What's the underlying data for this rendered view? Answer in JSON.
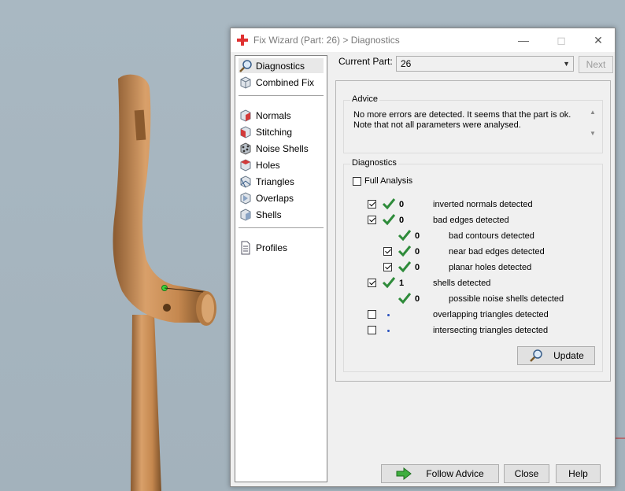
{
  "window": {
    "title": "Fix Wizard (Part: 26) > Diagnostics",
    "min_icon": "minimize-icon",
    "max_icon": "maximize-icon",
    "close_icon": "close-icon",
    "accent": "#e03131"
  },
  "nav": {
    "items": [
      {
        "label": "Diagnostics",
        "icon": "magnifier-icon",
        "selected": true
      },
      {
        "label": "Combined Fix",
        "icon": "cube-icon"
      },
      {
        "label": "Normals",
        "icon": "normals-cube-icon"
      },
      {
        "label": "Stitching",
        "icon": "stitching-cube-icon"
      },
      {
        "label": "Noise Shells",
        "icon": "noise-shells-icon"
      },
      {
        "label": "Holes",
        "icon": "holes-cube-icon"
      },
      {
        "label": "Triangles",
        "icon": "triangles-cube-icon"
      },
      {
        "label": "Overlaps",
        "icon": "overlaps-icon"
      },
      {
        "label": "Shells",
        "icon": "shells-icon"
      },
      {
        "label": "Profiles",
        "icon": "document-icon"
      }
    ]
  },
  "current_part": {
    "label": "Current Part:",
    "value": "26"
  },
  "next_button": "Next",
  "advice": {
    "title": "Advice",
    "text": "No more errors are detected. It seems that the part is ok.\nNote that not all parameters were analysed."
  },
  "diagnostics": {
    "title": "Diagnostics",
    "full_analysis": {
      "label": "Full Analysis",
      "checked": false
    },
    "rows": [
      {
        "checked": true,
        "status": "ok",
        "count": "0",
        "label": "inverted normals detected",
        "indent": 0
      },
      {
        "checked": true,
        "status": "ok",
        "count": "0",
        "label": "bad edges detected",
        "indent": 0
      },
      {
        "checked": null,
        "status": "ok",
        "count": "0",
        "label": "bad contours detected",
        "indent": 1
      },
      {
        "checked": true,
        "status": "ok",
        "count": "0",
        "label": "near bad edges detected",
        "indent": 1
      },
      {
        "checked": true,
        "status": "ok",
        "count": "0",
        "label": "planar holes detected",
        "indent": 1
      },
      {
        "checked": true,
        "status": "ok",
        "count": "1",
        "label": "shells detected",
        "indent": 0
      },
      {
        "checked": null,
        "status": "ok",
        "count": "0",
        "label": "possible noise shells detected",
        "indent": 1
      },
      {
        "checked": false,
        "status": "none",
        "count": "",
        "label": "overlapping triangles detected",
        "indent": 0
      },
      {
        "checked": false,
        "status": "none",
        "count": "",
        "label": "intersecting triangles detected",
        "indent": 0
      }
    ],
    "update_button": "Update"
  },
  "footer": {
    "follow_advice": "Follow Advice",
    "close": "Close",
    "help": "Help"
  },
  "colors": {
    "check_green": "#2e8b3a",
    "part_tan": "#c58a54"
  }
}
